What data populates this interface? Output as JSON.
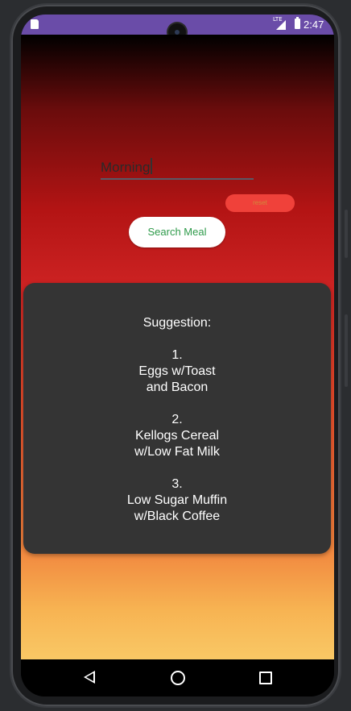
{
  "status_bar": {
    "network_label": "LTE",
    "time": "2:47"
  },
  "input": {
    "value": "Morning"
  },
  "buttons": {
    "reset_label": "reset",
    "search_label": "Search Meal"
  },
  "result": {
    "text": "Suggestion:\n\n1.\nEggs w/Toast\nand Bacon\n\n2.\nKellogs Cereal\nw/Low Fat Milk\n\n3.\nLow Sugar Muffin\nw/Black Coffee"
  },
  "colors": {
    "status_bar": "#6a4ca8",
    "reset_button": "#f0413a",
    "search_text": "#2e9a4a",
    "card": "#343434"
  }
}
